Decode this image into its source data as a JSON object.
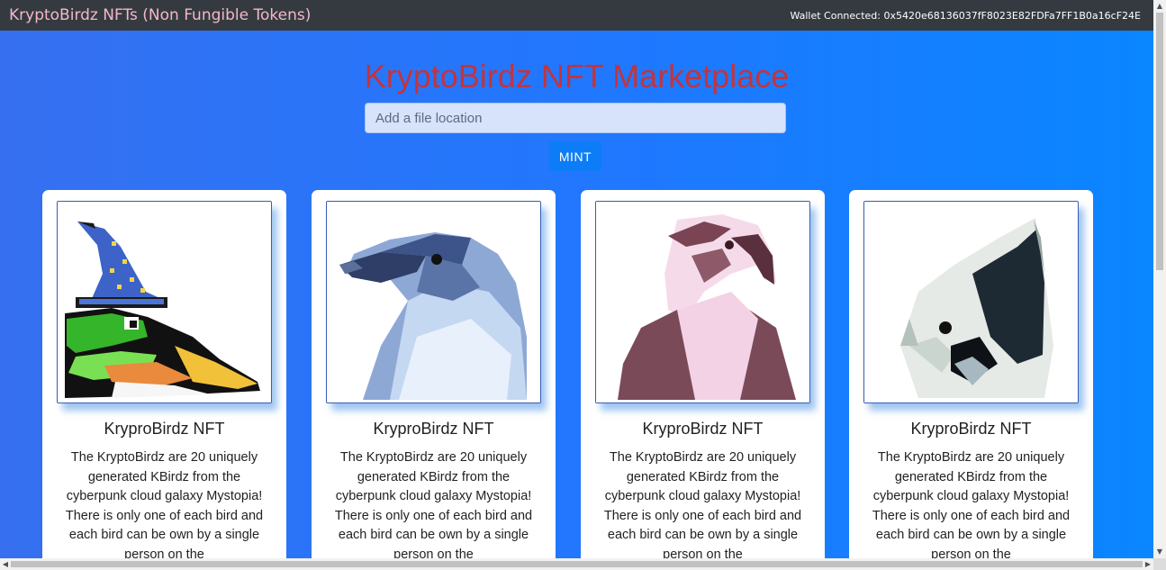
{
  "navbar": {
    "brand": "KryptoBirdz NFTs (Non Fungible Tokens)",
    "wallet": "Wallet Connected: 0x5420e68136037fF8023E82FDFa7FF1B0a16cF24E"
  },
  "main": {
    "title": "KryptoBirdz NFT Marketplace",
    "file_input": {
      "placeholder": "Add a file location",
      "value": ""
    },
    "mint_label": "MINT"
  },
  "cards": [
    {
      "image": "wizard-hat-bird-image",
      "title": "KryproBirdz NFT",
      "text": "The KryptoBirdz are 20 uniquely generated KBirdz from the cyberpunk cloud galaxy Mystopia! There is only one of each bird and each bird can be own by a single person on the"
    },
    {
      "image": "raven-image",
      "title": "KryproBirdz NFT",
      "text": "The KryptoBirdz are 20 uniquely generated KBirdz from the cyberpunk cloud galaxy Mystopia! There is only one of each bird and each bird can be own by a single person on the"
    },
    {
      "image": "eagle-image",
      "title": "KryproBirdz NFT",
      "text": "The KryptoBirdz are 20 uniquely generated KBirdz from the cyberpunk cloud galaxy Mystopia! There is only one of each bird and each bird can be own by a single person on the"
    },
    {
      "image": "crested-bird-image",
      "title": "KryproBirdz NFT",
      "text": "The KryptoBirdz are 20 uniquely generated KBirdz from the cyberpunk cloud galaxy Mystopia! There is only one of each bird and each bird can be own by a single person on the"
    }
  ],
  "colors": {
    "navbar_bg": "#343a40",
    "brand_text": "#f4b8c8",
    "title_text": "#c0353f",
    "page_bg": "#1f78ff",
    "mint_button": "#0d7df7"
  }
}
